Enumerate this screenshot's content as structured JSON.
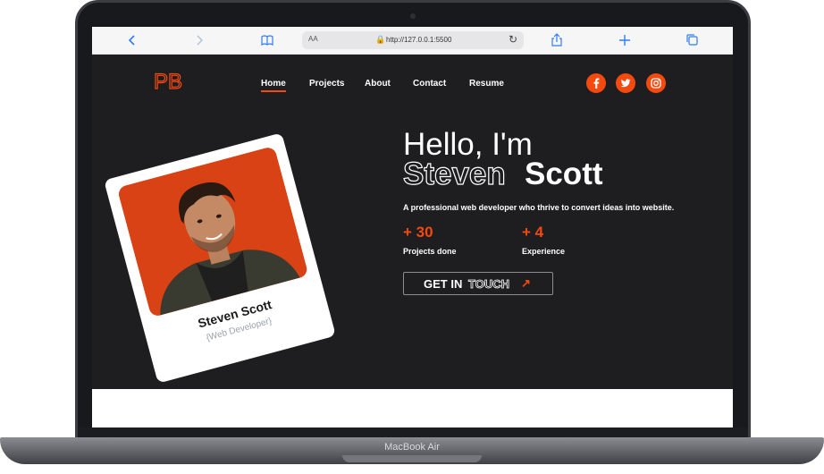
{
  "browser": {
    "aa_label": "AA",
    "url": "http://127.0.0.1:5500"
  },
  "site": {
    "logo": "PB",
    "nav": [
      "Home",
      "Projects",
      "About",
      "Contact",
      "Resume"
    ],
    "active_nav": "Home",
    "social": [
      {
        "name": "facebook-icon",
        "glyph": "f"
      },
      {
        "name": "twitter-icon",
        "glyph": "t"
      },
      {
        "name": "instagram-icon",
        "glyph": "i"
      }
    ],
    "card": {
      "name": "Steven Scott",
      "role": "{Web Developer}"
    },
    "hero": {
      "greeting": "Hello, I'm",
      "first_name": "Steven",
      "last_name": "Scott",
      "tagline": "A professional web developer who thrive to convert ideas into website.",
      "stats": [
        {
          "value": "+ 30",
          "label": "Projects done"
        },
        {
          "value": "+ 4",
          "label": "Experience"
        }
      ],
      "cta_part1": "GET IN",
      "cta_part2": "TOUCH",
      "cta_arrow": "↗"
    }
  },
  "device": {
    "label": "MacBook Air"
  },
  "colors": {
    "accent": "#f54a0f",
    "background": "#1e1d1f"
  }
}
